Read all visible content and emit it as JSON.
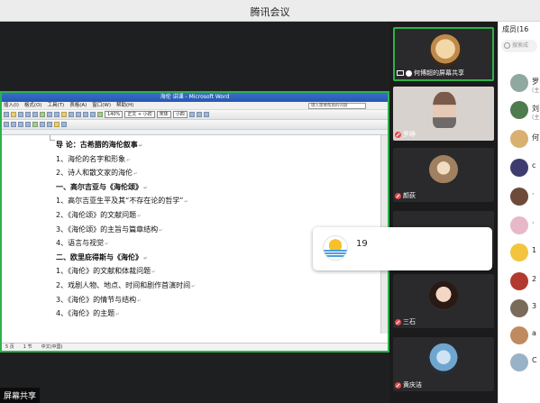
{
  "window": {
    "title": "腾讯会议"
  },
  "share": {
    "label": "屏幕共享"
  },
  "word": {
    "title": "海伦 讲课 - Microsoft Word",
    "menu": [
      "插入(I)",
      "格式(O)",
      "工具(T)",
      "表格(A)",
      "窗口(W)",
      "帮助(H)"
    ],
    "help_placeholder": "键入需要帮助的问题",
    "zoom": "140%",
    "style": "正文 + 小初",
    "font": "宋体",
    "size": "小四",
    "doc_lines": [
      "导  论：古希腊的海伦叙事",
      "1、海伦的名字和形象",
      "2、诗人和散文家的海伦",
      "一、高尔吉亚与《海伦颂》",
      "1、高尔吉亚生平及其“不存在论的哲学”",
      "2、《海伦颂》的文献问题",
      "3、《海伦颂》的主旨与篇章结构",
      "4、语言与视觉",
      "二、欧里庇得斯与《海伦》",
      "1、《海伦》的文献和体裁问题",
      "2、戏剧人物、地点、时间和剧作首演时间",
      "3、《海伦》的情节与结构",
      "4、《海伦》的主题"
    ],
    "status": {
      "page": "5 页",
      "section": "1 节",
      "lang": "中文(中国)"
    }
  },
  "participants": [
    {
      "name": "何博超的屏幕共享",
      "bg": "#4a3a2a",
      "sharing": true
    },
    {
      "name": "罗峥",
      "bg": "#d8d2cf"
    },
    {
      "name": "颜荻",
      "bg": "#2a2622"
    },
    {
      "name": "",
      "bg": "#2a2a2c"
    },
    {
      "name": "三石",
      "bg": "#3a3432"
    },
    {
      "name": "黄庆洁",
      "bg": "#2a2d33"
    }
  ],
  "chip": {
    "count": "19"
  },
  "members": {
    "header": "成员(16",
    "search_placeholder": "搜索成",
    "rows": [
      {
        "name": "罗",
        "sub": "(主",
        "color": "#8fa8a0"
      },
      {
        "name": "刘",
        "sub": "(主",
        "color": "#4f7c4f"
      },
      {
        "name": "何",
        "sub": "",
        "color": "#d9b070"
      },
      {
        "name": "c",
        "sub": "",
        "color": "#3c3c6e"
      },
      {
        "name": "·",
        "sub": "",
        "color": "#6e4a3a"
      },
      {
        "name": "·",
        "sub": "",
        "color": "#e7b9c8"
      },
      {
        "name": "1",
        "sub": "",
        "color": "#f2c53d"
      },
      {
        "name": "2",
        "sub": "",
        "color": "#b2392f"
      },
      {
        "name": "3",
        "sub": "",
        "color": "#7a6a5a"
      },
      {
        "name": "a",
        "sub": "",
        "color": "#c08a60"
      },
      {
        "name": "C",
        "sub": "",
        "color": "#9ab2c6"
      }
    ]
  }
}
